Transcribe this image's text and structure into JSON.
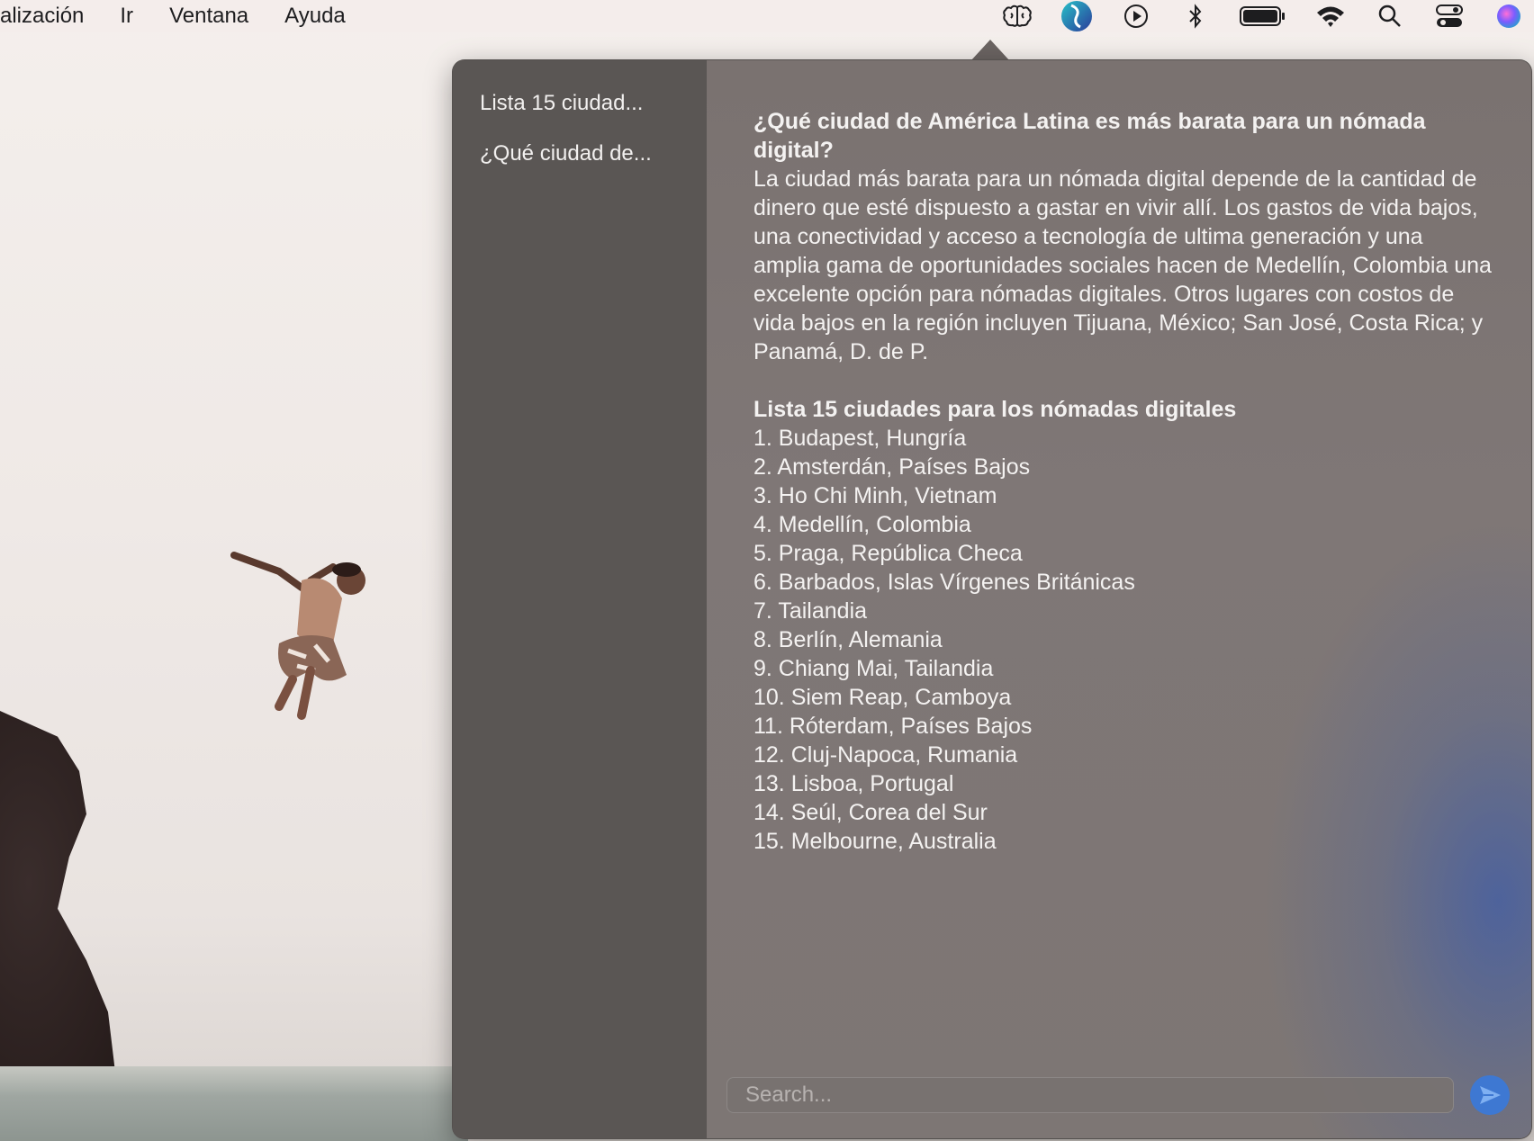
{
  "menubar": {
    "items": [
      "alización",
      "Ir",
      "Ventana",
      "Ayuda"
    ],
    "status_icons": [
      "brain-icon",
      "app-logo-icon",
      "play-icon",
      "bluetooth-icon",
      "battery-icon",
      "wifi-icon",
      "search-icon",
      "control-center-icon",
      "siri-icon"
    ]
  },
  "sidebar": {
    "items": [
      {
        "label": "Lista 15 ciudad..."
      },
      {
        "label": "¿Qué ciudad de..."
      }
    ]
  },
  "chat": {
    "question": "¿Qué ciudad de América Latina es más barata para un nómada digital?",
    "answer": "La ciudad más barata para un nómada digital depende de la cantidad de dinero que esté dispuesto a gastar en vivir allí. Los gastos de vida bajos, una conectividad y acceso a tecnología de ultima generación y una amplia gama de oportunidades sociales hacen de Medellín, Colombia una excelente opción para nómadas digitales. Otros lugares con costos de vida bajos en la región incluyen Tijuana, México; San José, Costa Rica; y Panamá, D. de P.",
    "list_title": "Lista 15 ciudades para los nómadas digitales",
    "list": [
      "1. Budapest, Hungría",
      "2. Amsterdán, Países Bajos",
      "3. Ho Chi Minh, Vietnam",
      "4. Medellín, Colombia",
      "5. Praga, República Checa",
      "6. Barbados, Islas Vírgenes Británicas",
      "7. Tailandia",
      "8. Berlín, Alemania",
      "9. Chiang Mai, Tailandia",
      "10. Siem Reap, Camboya",
      "11. Róterdam, Países Bajos",
      "12. Cluj-Napoca, Rumania",
      "13. Lisboa, Portugal",
      "14. Seúl, Corea del Sur",
      "15. Melbourne, Australia"
    ]
  },
  "search": {
    "placeholder": "Search...",
    "value": ""
  },
  "colors": {
    "accent": "#3e78d2",
    "sidebar_bg": "#5a5654",
    "content_bg": "#7d7674"
  }
}
